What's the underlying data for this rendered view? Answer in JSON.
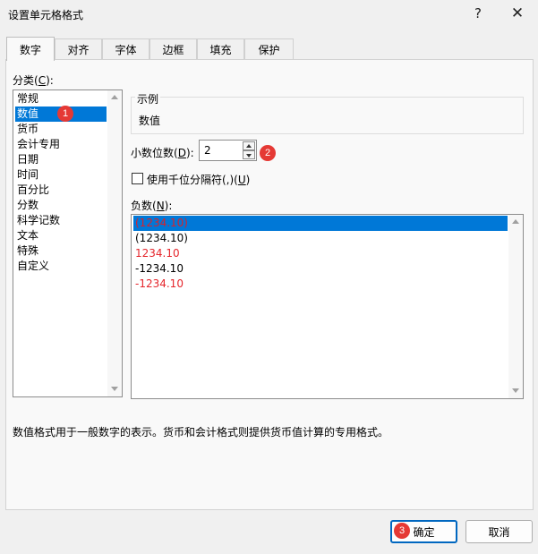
{
  "window": {
    "title": "设置单元格格式",
    "help": "?",
    "close": "✕"
  },
  "tabs": [
    {
      "label": "数字",
      "active": true
    },
    {
      "label": "对齐"
    },
    {
      "label": "字体"
    },
    {
      "label": "边框"
    },
    {
      "label": "填充"
    },
    {
      "label": "保护"
    }
  ],
  "category": {
    "label_pre": "分类(",
    "label_key": "C",
    "label_post": "):",
    "items": [
      "常规",
      "数值",
      "货币",
      "会计专用",
      "日期",
      "时间",
      "百分比",
      "分数",
      "科学记数",
      "文本",
      "特殊",
      "自定义"
    ],
    "selected_index": 1
  },
  "sample": {
    "title": "示例",
    "value": "数值"
  },
  "decimal": {
    "label_pre": "小数位数(",
    "label_key": "D",
    "label_post": "):",
    "value": "2"
  },
  "thousands": {
    "label_pre": "使用千位分隔符(,)(",
    "label_key": "U",
    "label_post": ")",
    "checked": false
  },
  "negative": {
    "label_pre": "负数(",
    "label_key": "N",
    "label_post": "):",
    "items": [
      {
        "text": "(1234.10)",
        "color": "#d8222a"
      },
      {
        "text": "(1234.10)",
        "color": "#000000"
      },
      {
        "text": "1234.10",
        "color": "#e5262c"
      },
      {
        "text": "-1234.10",
        "color": "#000000"
      },
      {
        "text": "-1234.10",
        "color": "#e5262c"
      }
    ],
    "selected_index": 0
  },
  "description": "数值格式用于一般数字的表示。货币和会计格式则提供货币值计算的专用格式。",
  "buttons": {
    "ok": "确定",
    "cancel": "取消"
  },
  "badges": [
    "1",
    "2",
    "3"
  ],
  "colors": {
    "accent": "#0078d7",
    "badge": "#e53935"
  }
}
